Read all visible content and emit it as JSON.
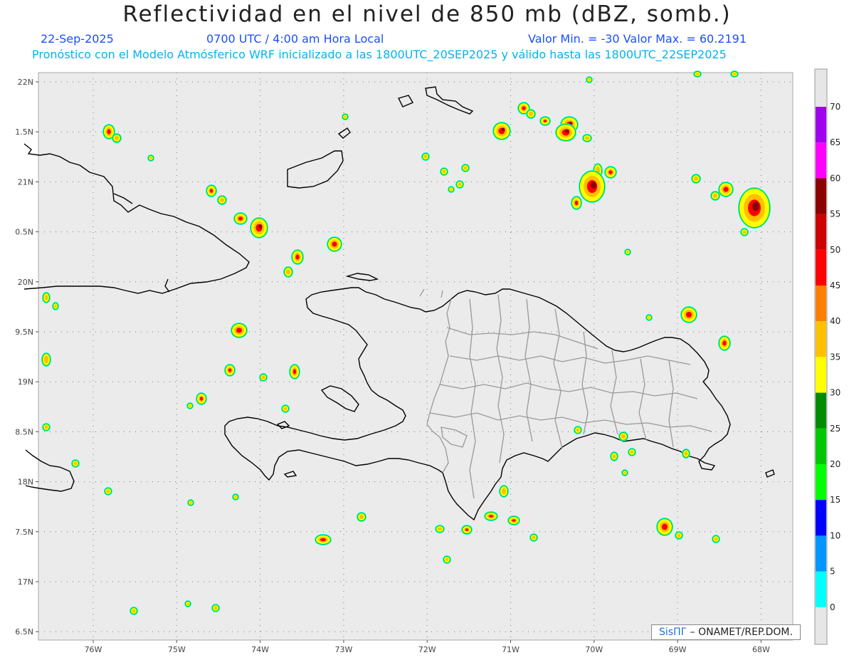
{
  "header": {
    "title": "Reflectividad en el nivel de 850 mb (dBZ, somb.)",
    "date": "22-Sep-2025",
    "time": "0700 UTC / 4:00 am Hora Local",
    "minmax": "Valor Min. = -30  Valor Max. = 60.2191",
    "forecast_line": "Pronóstico con el Modelo Atmósferico WRF inicializado a las 1800UTC_20SEP2025 y válido hasta las  1800UTC_22SEP2025"
  },
  "map": {
    "lat_ticks": [
      "22N",
      "1.5N",
      "21N",
      "0.5N",
      "20N",
      "9.5N",
      "19N",
      "8.5N",
      "18N",
      "7.5N",
      "17N",
      "6.5N"
    ],
    "lon_ticks": [
      "76W",
      "75W",
      "74W",
      "73W",
      "72W",
      "71W",
      "70W",
      "69W",
      "68W"
    ],
    "background_color": "#ebebeb"
  },
  "colorbar": {
    "labels": [
      "70",
      "65",
      "60",
      "55",
      "50",
      "45",
      "40",
      "35",
      "30",
      "25",
      "20",
      "15",
      "10",
      "5",
      "0"
    ],
    "colors": [
      "#a000f0",
      "#ff00ff",
      "#8b0000",
      "#cc0000",
      "#ff0000",
      "#ff7f00",
      "#ffc000",
      "#ffff00",
      "#008c00",
      "#00c800",
      "#00ff00",
      "#0000ff",
      "#0096ff",
      "#00ffff",
      "#e6e6e6"
    ]
  },
  "credit": {
    "logo": "SisПГ",
    "text": "– ONAMET/REP.DOM."
  }
}
